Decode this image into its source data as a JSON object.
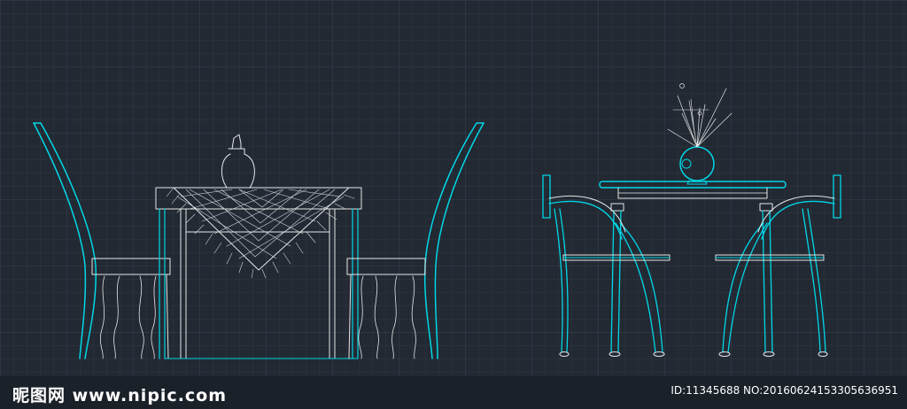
{
  "drawing": {
    "background": "#222933",
    "grid_color": "#2f3946",
    "grid_major_color": "#36414f",
    "line_cyan": "#00d7e6",
    "line_white": "#e6e6e6",
    "left_group": "table with tablecloth, vase and two chairs (front elevation)",
    "right_group": "round-vase table with two metal chairs (front elevation)"
  },
  "watermark": {
    "logo": "昵图网 www.nipic.com",
    "id_text": "ID:11345688 NO:20160624153305636951"
  }
}
